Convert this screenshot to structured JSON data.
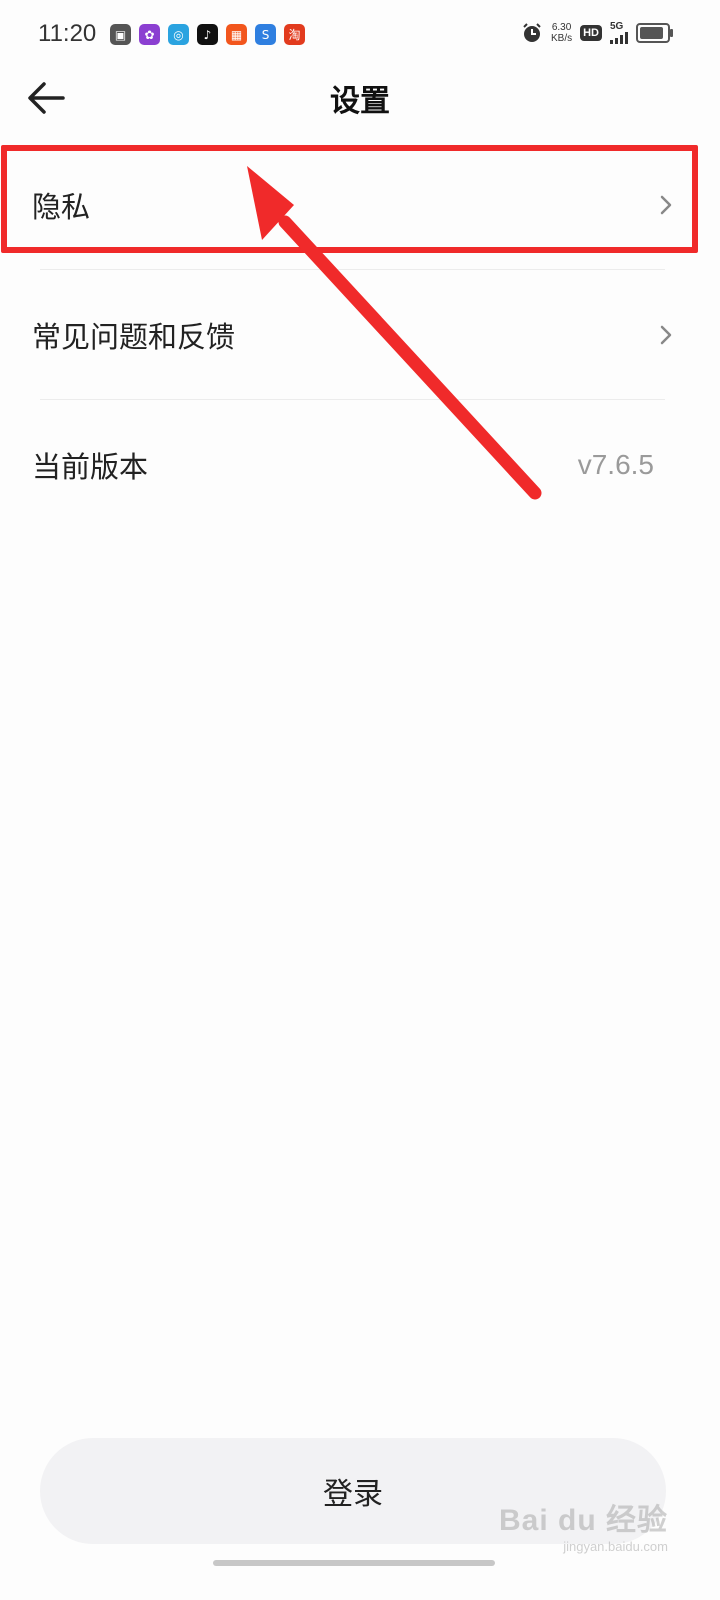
{
  "status_bar": {
    "time": "11:20",
    "app_icons": [
      {
        "name": "gallery-app-icon",
        "color": "#555555",
        "glyph": "▣"
      },
      {
        "name": "character-app-icon",
        "color": "#8b3fd1",
        "glyph": "✿"
      },
      {
        "name": "browser-app-icon",
        "color": "#2aa3e0",
        "glyph": "◎"
      },
      {
        "name": "tiktok-app-icon",
        "color": "#111111",
        "glyph": "♪"
      },
      {
        "name": "kuaishou-app-icon",
        "color": "#f2561d",
        "glyph": "▦"
      },
      {
        "name": "search-app-icon",
        "color": "#2f7fe0",
        "glyph": "S"
      },
      {
        "name": "taobao-app-icon",
        "color": "#e23b1e",
        "glyph": "淘"
      }
    ],
    "net_speed_value": "6.30",
    "net_speed_unit": "KB/s",
    "hd_label": "HD",
    "network_label": "5G"
  },
  "header": {
    "title": "设置"
  },
  "settings": {
    "items": [
      {
        "label": "隐私",
        "has_chevron": true
      },
      {
        "label": "常见问题和反馈",
        "has_chevron": true
      },
      {
        "label": "当前版本",
        "value": "v7.6.5"
      }
    ]
  },
  "login": {
    "label": "登录"
  },
  "watermark": {
    "main": "Bai du 经验",
    "sub": "jingyan.baidu.com"
  },
  "colors": {
    "annotation_red": "#f02a2a",
    "background": "#fdfdfd",
    "login_button_bg": "#f2f2f4"
  }
}
